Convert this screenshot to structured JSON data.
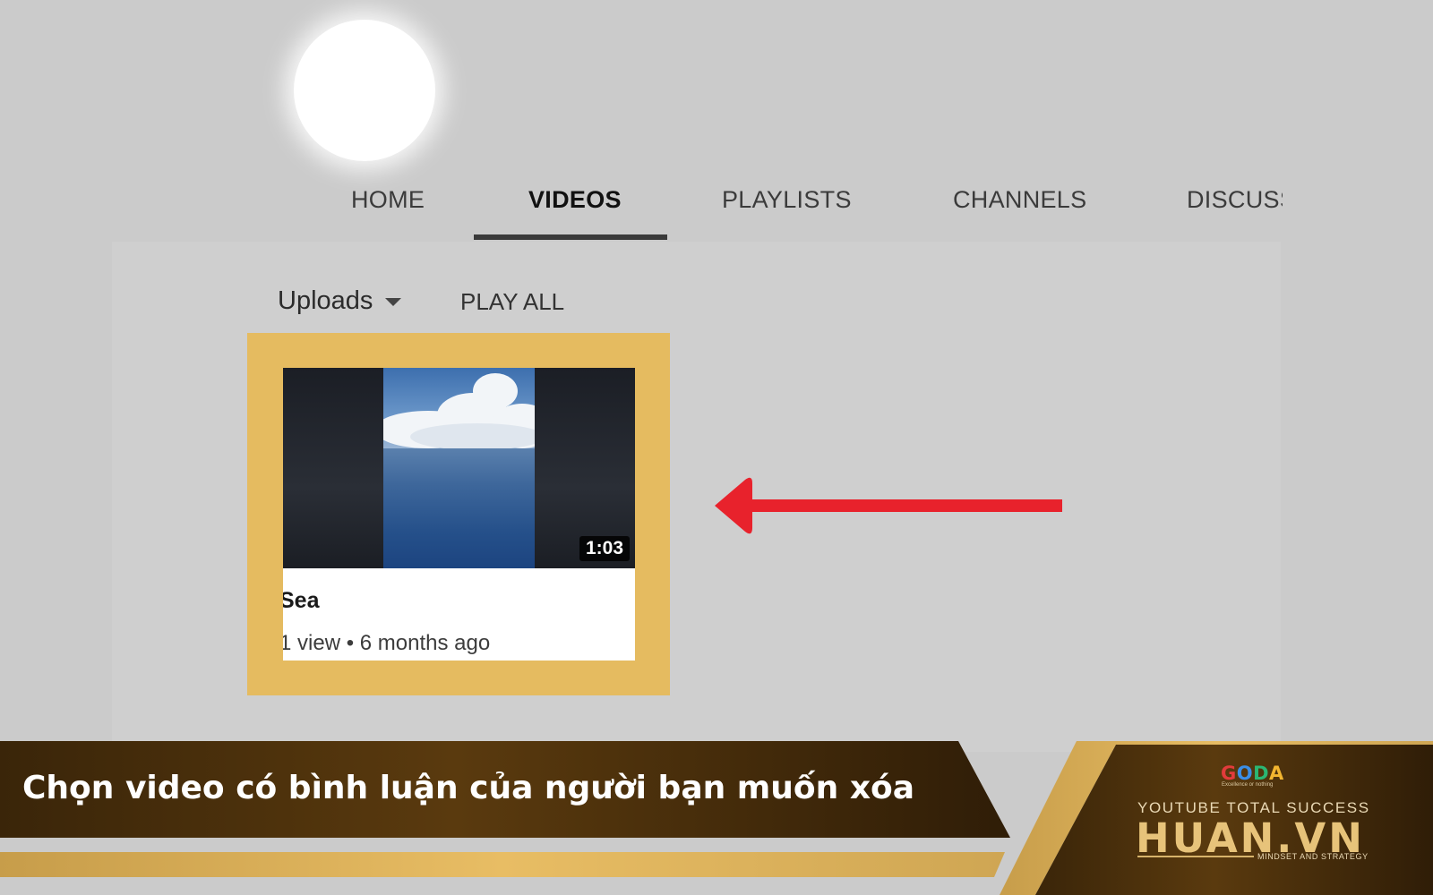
{
  "tabs": [
    {
      "label": "HOME"
    },
    {
      "label": "VIDEOS",
      "active": true
    },
    {
      "label": "PLAYLISTS"
    },
    {
      "label": "CHANNELS"
    },
    {
      "label": "DISCUSS"
    }
  ],
  "toolbar": {
    "uploads_label": "Uploads",
    "play_all_label": "PLAY ALL"
  },
  "video": {
    "title": "Sea",
    "meta": "1 view • 6 months ago",
    "duration": "1:03"
  },
  "banner": {
    "caption": "Chọn video có bình luận của người bạn muốn xóa"
  },
  "logo": {
    "goda": [
      "G",
      "O",
      "D",
      "A"
    ],
    "goda_colors": [
      "#e23b3b",
      "#3a8ee6",
      "#2bb673",
      "#f2b530"
    ],
    "tagline": "Excellence or nothing",
    "subtitle": "YOUTUBE TOTAL SUCCESS",
    "main": "HUAN.VN",
    "mindset": "MINDSET AND STRATEGY"
  },
  "colors": {
    "highlight": "#e5bb60",
    "arrow": "#e8222c",
    "banner_dark": "#3b260c",
    "banner_gold": "#e3b35c",
    "background": "#cbcbcb"
  },
  "icons": [
    "dropdown-caret-icon",
    "left-arrow-annotation-icon"
  ]
}
